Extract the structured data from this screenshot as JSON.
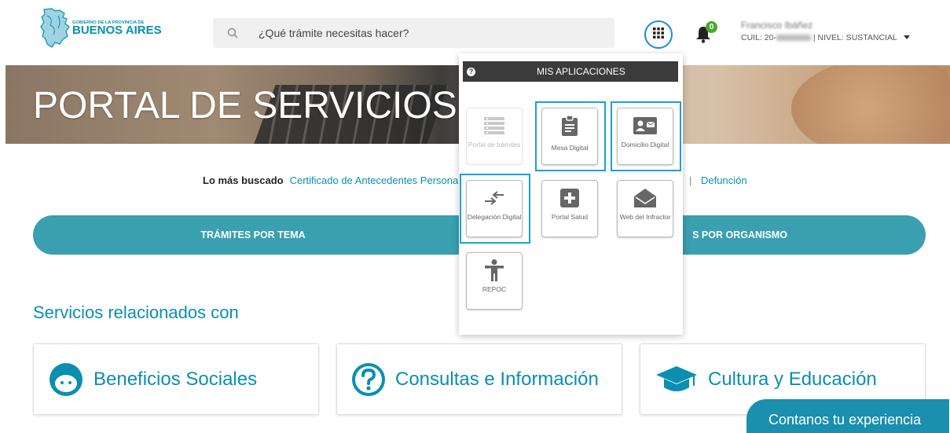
{
  "header": {
    "logo": {
      "small_text": "GOBIERNO DE LA PROVINCIA DE",
      "big_text": "BUENOS AIRES",
      "icon": "province-map-icon"
    },
    "search": {
      "placeholder": "¿Qué trámite necesitas hacer?",
      "icon": "search-icon"
    },
    "apps_icon": "grid-icon",
    "notifications": {
      "icon": "bell-icon",
      "count": "0"
    },
    "user": {
      "name": "Francisco Ibáñez",
      "cuil": "CUIL: 20-",
      "level": "| NIVEL: SUSTANCIAL"
    }
  },
  "banner": {
    "title": "PORTAL DE SERVICIOS"
  },
  "most_searched": {
    "label": "Lo más buscado",
    "links": [
      "Certificado de Antecedentes Persona",
      "Defunción"
    ],
    "separator": "|"
  },
  "pills": {
    "left": "TRÁMITES POR TEMA",
    "right": "S POR ORGANISMO"
  },
  "related": {
    "title": "Servicios relacionados con",
    "cards": [
      {
        "label": "Beneficios Sociales",
        "icon": "child-face-icon"
      },
      {
        "label": "Consultas e Información",
        "icon": "question-circle-icon"
      },
      {
        "label": "Cultura y Educación",
        "icon": "graduation-cap-icon"
      }
    ]
  },
  "feedback": {
    "label": "Contanos tu experiencia"
  },
  "apps_panel": {
    "title": "MIS APLICACIONES",
    "help_icon": "question-icon",
    "apps": [
      {
        "label": "Portal de trámites",
        "icon": "list-icon",
        "disabled": true,
        "highlighted": false
      },
      {
        "label": "Mesa Digital",
        "icon": "clipboard-icon",
        "disabled": false,
        "highlighted": true
      },
      {
        "label": "Domicilio Digital",
        "icon": "id-card-icon",
        "disabled": false,
        "highlighted": true
      },
      {
        "label": "Delegación Digital",
        "icon": "arrows-exchange-icon",
        "disabled": false,
        "highlighted": true
      },
      {
        "label": "Portal Salud",
        "icon": "plus-square-icon",
        "disabled": false,
        "highlighted": false
      },
      {
        "label": "Web del Infractor",
        "icon": "envelope-open-icon",
        "disabled": false,
        "highlighted": false
      },
      {
        "label": "REPOC",
        "icon": "accessibility-icon",
        "disabled": false,
        "highlighted": false
      }
    ]
  },
  "colors": {
    "brand": "#0a8fb0",
    "pill": "#3a9fae",
    "highlight": "#1aa0d8",
    "badge": "#46a82e",
    "feedback": "#1a8fae"
  }
}
